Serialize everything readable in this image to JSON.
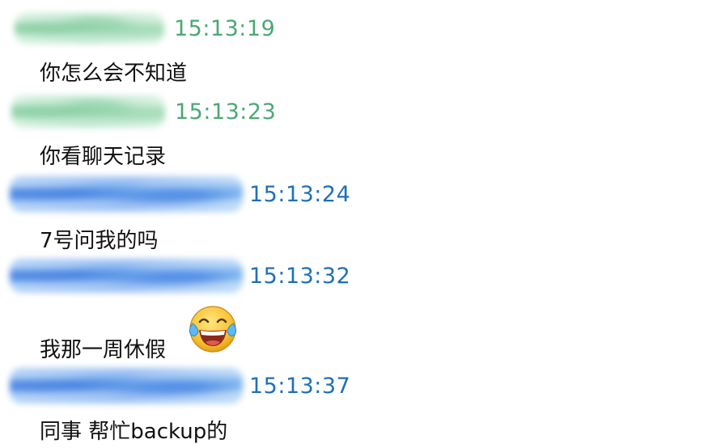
{
  "messages": [
    {
      "time": "15:13:19",
      "text": "你怎么会不知道",
      "name_style": "green"
    },
    {
      "time": "15:13:23",
      "text": "你看聊天记录",
      "name_style": "green"
    },
    {
      "time": "15:13:24",
      "text": "7号问我的吗",
      "name_style": "blue"
    },
    {
      "time": "15:13:32",
      "text": "我那一周休假",
      "name_style": "blue",
      "emoji": "tears-of-joy-emoji"
    },
    {
      "time": "15:13:37",
      "text": "同事 帮忙backup的",
      "name_style": "blue"
    }
  ],
  "colors": {
    "green_time": "#4aa874",
    "blue_time": "#1f6fb8",
    "text": "#111111",
    "background": "#ffffff"
  }
}
